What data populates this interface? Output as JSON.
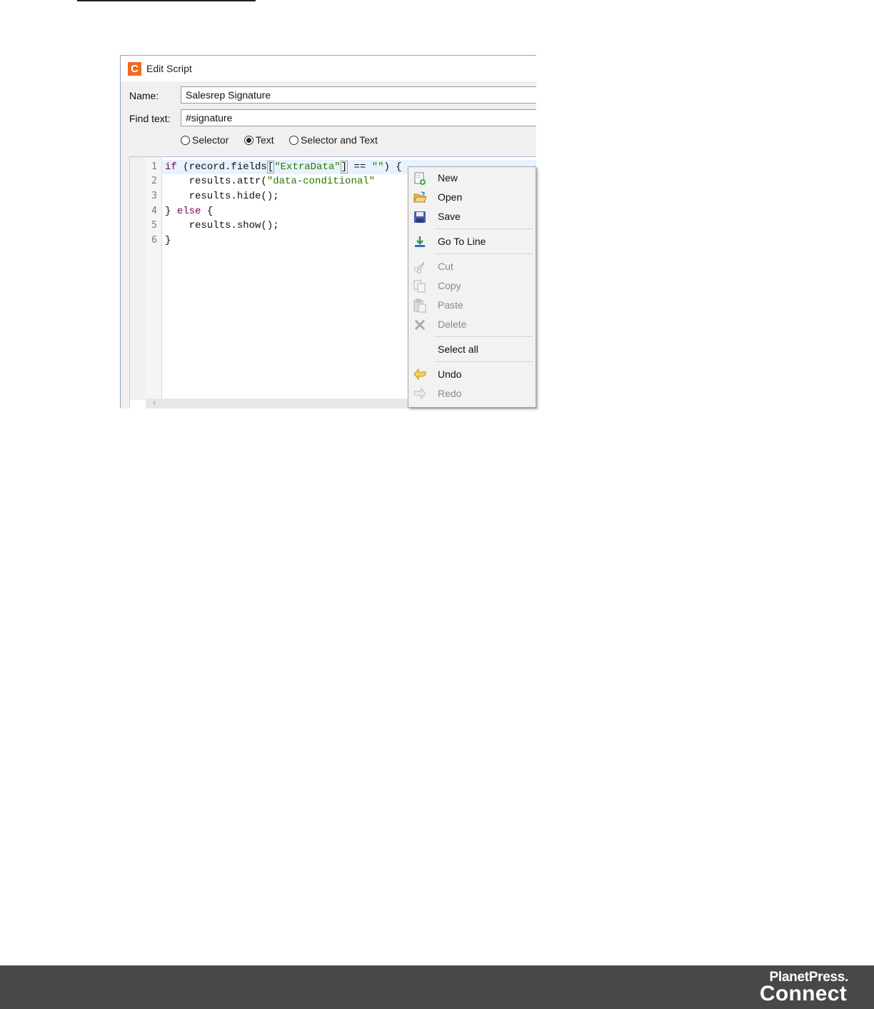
{
  "dialog": {
    "title": "Edit Script",
    "app_icon_letter": "C",
    "name_label": "Name:",
    "name_value": "Salesrep Signature",
    "find_label": "Find text:",
    "find_value": "#signature",
    "radios": [
      {
        "label": "Selector",
        "selected": false
      },
      {
        "label": "Text",
        "selected": true
      },
      {
        "label": "Selector and Text",
        "selected": false
      }
    ]
  },
  "editor": {
    "line_numbers": [
      "1",
      "2",
      "3",
      "4",
      "5",
      "6"
    ],
    "code": [
      {
        "kw1": "if",
        "t1": " (record.fields",
        "b1": "[",
        "s1": "\"ExtraData\"",
        "b2": "]",
        "t2": " == ",
        "s2": "\"\"",
        "t3": ") {"
      },
      {
        "t1": "    results.attr(",
        "s1": "\"data-conditional\""
      },
      {
        "t1": "    results.hide();"
      },
      {
        "t1": "} ",
        "kw1": "else",
        "t2": " {"
      },
      {
        "t1": "    results.show();"
      },
      {
        "t1": "}"
      }
    ]
  },
  "context_menu": {
    "items": [
      {
        "label": "New",
        "icon": "new-file-icon",
        "enabled": true
      },
      {
        "label": "Open",
        "icon": "open-folder-icon",
        "enabled": true
      },
      {
        "label": "Save",
        "icon": "save-icon",
        "enabled": true
      },
      {
        "label": "Go To Line",
        "icon": "go-to-line-icon",
        "enabled": true
      },
      {
        "label": "Cut",
        "icon": "cut-icon",
        "enabled": false
      },
      {
        "label": "Copy",
        "icon": "copy-icon",
        "enabled": false
      },
      {
        "label": "Paste",
        "icon": "paste-icon",
        "enabled": false
      },
      {
        "label": "Delete",
        "icon": "delete-icon",
        "enabled": false
      },
      {
        "label": "Select all",
        "icon": "",
        "enabled": true
      },
      {
        "label": "Undo",
        "icon": "undo-icon",
        "enabled": true
      },
      {
        "label": "Redo",
        "icon": "redo-icon",
        "enabled": false
      }
    ]
  },
  "footer": {
    "brand_line1": "PlanetPress.",
    "brand_line2": "Connect"
  },
  "colors": {
    "accent": "#ef6c1f",
    "footer_bg": "#474946",
    "keyword": "#7f0055",
    "string": "#2a7a00"
  }
}
